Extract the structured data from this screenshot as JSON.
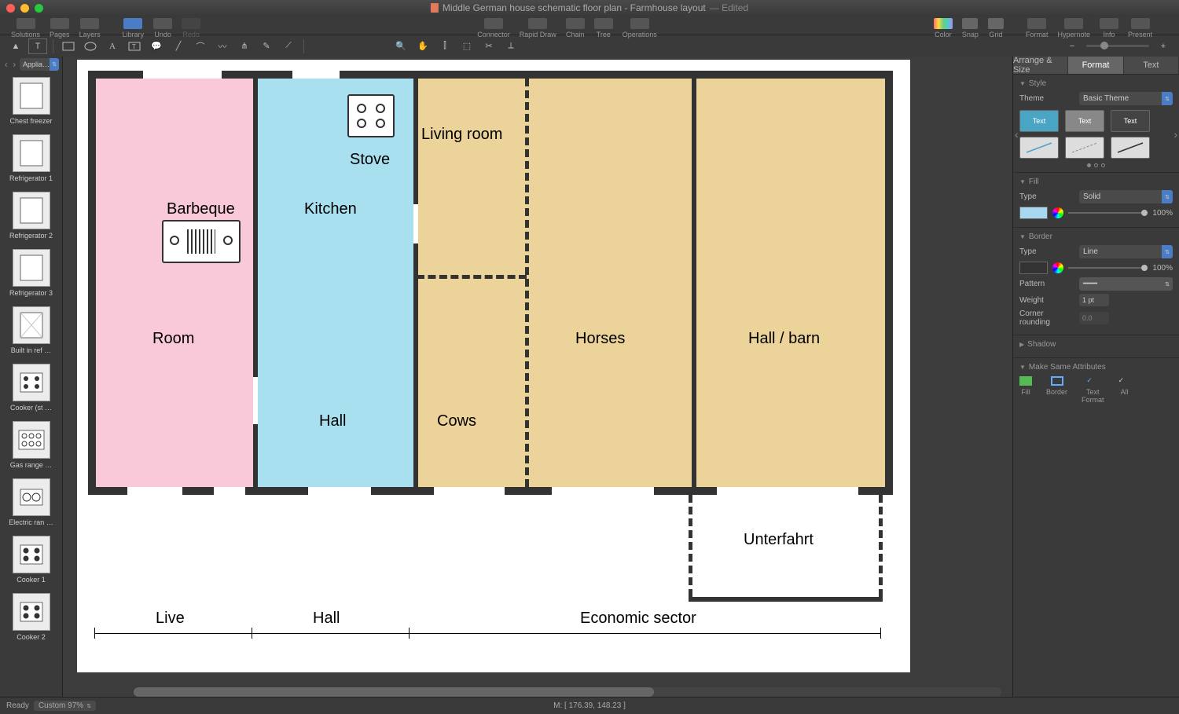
{
  "window": {
    "title": "Middle German house schematic floor plan - Farmhouse layout",
    "edited": "— Edited"
  },
  "toolbar": {
    "solutions": "Solutions",
    "pages": "Pages",
    "layers": "Layers",
    "library": "Library",
    "undo": "Undo",
    "redo": "Redo",
    "connector": "Connector",
    "rapid_draw": "Rapid Draw",
    "chain": "Chain",
    "tree": "Tree",
    "operations": "Operations",
    "color": "Color",
    "snap": "Snap",
    "grid": "Grid",
    "format": "Format",
    "hypernote": "Hypernote",
    "info": "Info",
    "present": "Present"
  },
  "library": {
    "selected": "Applia…",
    "items": [
      {
        "label": "Chest freezer"
      },
      {
        "label": "Refrigerator 1"
      },
      {
        "label": "Refrigerator 2"
      },
      {
        "label": "Refrigerator 3"
      },
      {
        "label": "Built in ref …"
      },
      {
        "label": "Cooker (st …"
      },
      {
        "label": "Gas range …"
      },
      {
        "label": "Electric ran …"
      },
      {
        "label": "Cooker 1"
      },
      {
        "label": "Cooker 2"
      }
    ]
  },
  "floorplan": {
    "room": "Room",
    "barbeque": "Barbeque",
    "kitchen": "Kitchen",
    "stove": "Stove",
    "hall": "Hall",
    "living_room": "Living room",
    "cows": "Cows",
    "horses": "Horses",
    "hall_barn": "Hall / barn",
    "unterfahrt": "Unterfahrt",
    "dim_live": "Live",
    "dim_hall": "Hall",
    "dim_economic": "Economic sector"
  },
  "inspector": {
    "tab_arrange": "Arrange & Size",
    "tab_format": "Format",
    "tab_text": "Text",
    "style": "Style",
    "theme": "Theme",
    "theme_value": "Basic Theme",
    "card_text": "Text",
    "fill": "Fill",
    "type": "Type",
    "solid": "Solid",
    "opacity": "100%",
    "border": "Border",
    "line": "Line",
    "pattern": "Pattern",
    "weight": "Weight",
    "weight_val": "1 pt",
    "corner": "Corner rounding",
    "corner_val": "0.0",
    "shadow": "Shadow",
    "make_same": "Make Same Attributes",
    "ms_fill": "Fill",
    "ms_border": "Border",
    "ms_text": "Text\nFormat",
    "ms_all": "All"
  },
  "status": {
    "ready": "Ready",
    "zoom": "Custom 97%",
    "coords": "M: [ 176.39, 148.23 ]"
  }
}
